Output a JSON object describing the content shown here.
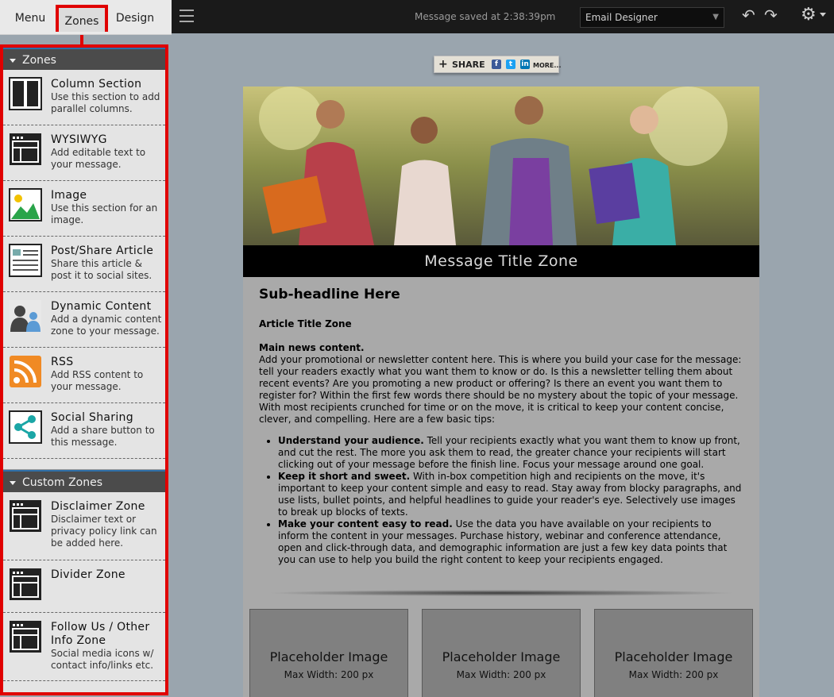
{
  "nav": {
    "menu": "Menu",
    "zones": "Zones",
    "design": "Design"
  },
  "topbar": {
    "saved": "Message saved at 2:38:39pm",
    "designer": "Email Designer"
  },
  "panel": {
    "zones_header": "Zones",
    "zones": [
      {
        "title": "Column Section",
        "desc": "Use this section to add parallel columns."
      },
      {
        "title": "WYSIWYG",
        "desc": "Add editable text to your message."
      },
      {
        "title": "Image",
        "desc": "Use this section for an image."
      },
      {
        "title": "Post/Share Article",
        "desc": "Share this article & post it to social sites."
      },
      {
        "title": "Dynamic Content",
        "desc": "Add a dynamic content zone to your message."
      },
      {
        "title": "RSS",
        "desc": "Add RSS content to your message."
      },
      {
        "title": "Social Sharing",
        "desc": "Add a share button to this message."
      }
    ],
    "custom_header": "Custom Zones",
    "custom": [
      {
        "title": "Disclaimer Zone",
        "desc": "Disclaimer text or privacy policy link can be added here."
      },
      {
        "title": "Divider Zone",
        "desc": ""
      },
      {
        "title": "Follow Us / Other Info Zone",
        "desc": "Social media icons w/ contact info/links etc."
      }
    ]
  },
  "share": {
    "label": "SHARE",
    "more": "MORE..."
  },
  "email": {
    "title_zone": "Message Title Zone",
    "subhead": "Sub-headline Here",
    "article_title": "Article Title Zone",
    "main_label": "Main news content.",
    "main_text": "Add your promotional or newsletter content here. This is where you build your case for the message: tell your readers exactly what you want them to know or do. Is this a newsletter telling them about recent events? Are you promoting a new product or offering? Is there an event you want them to register for? Within the first few words there should be no mystery about the topic of your message. With most recipients crunched for time or on the move, it is critical to keep your content concise, clever, and compelling. Here are a few basic tips:",
    "tips": [
      {
        "bold": "Understand your audience.",
        "text": " Tell your recipients exactly what you want them to know up front, and cut the rest. The more you ask them to read, the greater chance your recipients will start clicking out of your message before the finish line. Focus your message around one goal."
      },
      {
        "bold": "Keep it short and sweet.",
        "text": " With in-box competition high and recipients on the move, it's important to keep your content simple and easy to read. Stay away from blocky paragraphs, and use lists, bullet points, and helpful headlines to guide your reader's eye. Selectively use images to break up blocks of texts."
      },
      {
        "bold": "Make your content easy to read.",
        "text": " Use the data you have available on your recipients to inform the content in your messages. Purchase history, webinar and conference attendance, open and click-through data, and demographic information are just a few key data points that you can use to help you build the right content to keep your recipients engaged."
      }
    ],
    "placeholder_title": "Placeholder Image",
    "placeholder_sub": "Max Width: 200 px"
  }
}
